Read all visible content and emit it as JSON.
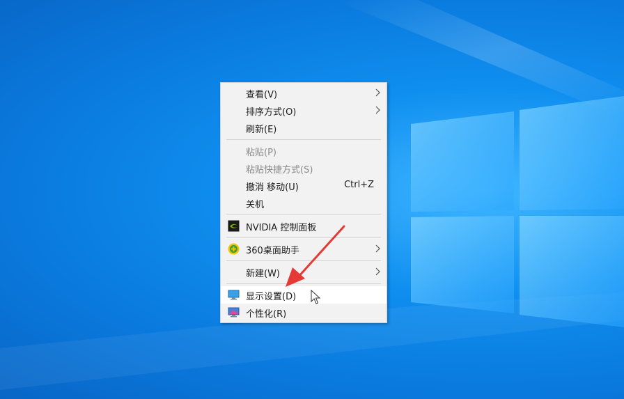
{
  "colors": {
    "desktop_bg": "#0a78dc",
    "menu_bg": "#f2f2f2",
    "menu_highlight": "#ffffff",
    "arrow": "#e53935",
    "disabled_text": "#8a8a8a"
  },
  "menu": {
    "items": [
      {
        "label": "查看(V)",
        "submenu": true
      },
      {
        "label": "排序方式(O)",
        "submenu": true
      },
      {
        "label": "刷新(E)"
      },
      {
        "label": "粘贴(P)",
        "disabled": true
      },
      {
        "label": "粘贴快捷方式(S)",
        "disabled": true
      },
      {
        "label": "撤消 移动(U)",
        "shortcut": "Ctrl+Z"
      },
      {
        "label": "关机"
      },
      {
        "label": "NVIDIA 控制面板",
        "icon": "nvidia-icon"
      },
      {
        "label": "360桌面助手",
        "icon": "360-icon",
        "submenu": true
      },
      {
        "label": "新建(W)",
        "submenu": true
      },
      {
        "label": "显示设置(D)",
        "icon": "display-icon",
        "highlighted": true
      },
      {
        "label": "个性化(R)",
        "icon": "personalize-icon"
      }
    ]
  }
}
